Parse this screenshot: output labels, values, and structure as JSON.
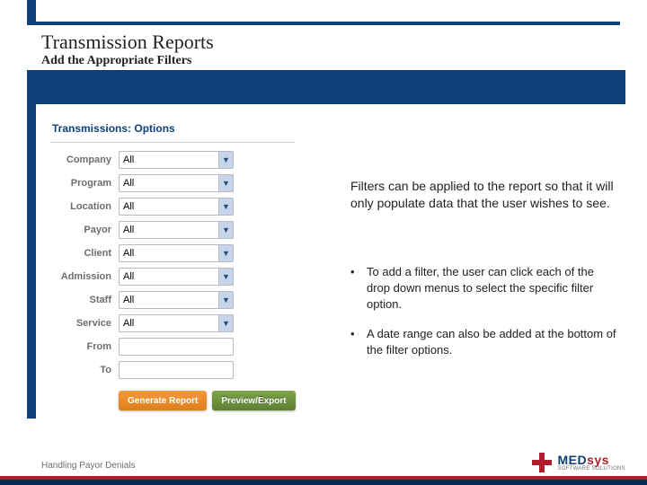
{
  "header": {
    "title": "Transmission Reports",
    "subtitle": "Add the Appropriate Filters"
  },
  "filter_panel": {
    "heading": "Transmissions: Options",
    "rows": [
      {
        "label": "Company",
        "value": "All",
        "type": "select"
      },
      {
        "label": "Program",
        "value": "All",
        "type": "select"
      },
      {
        "label": "Location",
        "value": "All",
        "type": "select"
      },
      {
        "label": "Payor",
        "value": "All",
        "type": "select"
      },
      {
        "label": "Client",
        "value": "All",
        "type": "select"
      },
      {
        "label": "Admission",
        "value": "All",
        "type": "select"
      },
      {
        "label": "Staff",
        "value": "All",
        "type": "select"
      },
      {
        "label": "Service",
        "value": "All",
        "type": "select"
      },
      {
        "label": "From",
        "value": "",
        "type": "text"
      },
      {
        "label": "To",
        "value": "",
        "type": "text"
      }
    ],
    "buttons": {
      "generate": "Generate Report",
      "preview": "Preview/Export"
    }
  },
  "explanation": "Filters can be applied to the report so that it will only populate data that the user wishes to see.",
  "bullets": [
    "To add a filter, the user can click each of the drop down menus to select the specific filter option.",
    "A date range can also be added at the bottom of the filter options."
  ],
  "footer": {
    "left": "Handling Payor Denials",
    "brand_primary": "MED",
    "brand_secondary": "sys",
    "brand_tag": "SOFTWARE SOLUTIONS"
  }
}
